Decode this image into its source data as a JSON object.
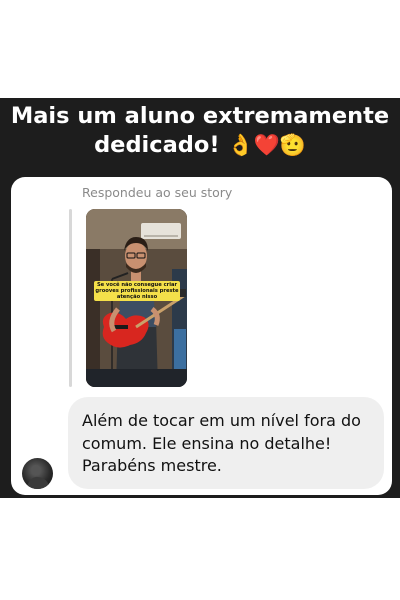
{
  "headline": {
    "line1": "Mais um aluno extremamente",
    "line2": "dedicado!",
    "emojis": "👌❤️🫡"
  },
  "reply": {
    "label": "Respondeu ao seu story"
  },
  "story": {
    "caption": "Se você não consegue criar grooves profissionais preste atenção nisso"
  },
  "message": {
    "line1": "Além de tocar em um nível fora do",
    "line2": "comum. Ele ensina no detalhe!",
    "line3": "Parabéns mestre."
  },
  "colors": {
    "panel": "#1d1d1d",
    "bubble": "#efefef",
    "bass": "#d8261f",
    "sticker": "#f4e04a"
  }
}
